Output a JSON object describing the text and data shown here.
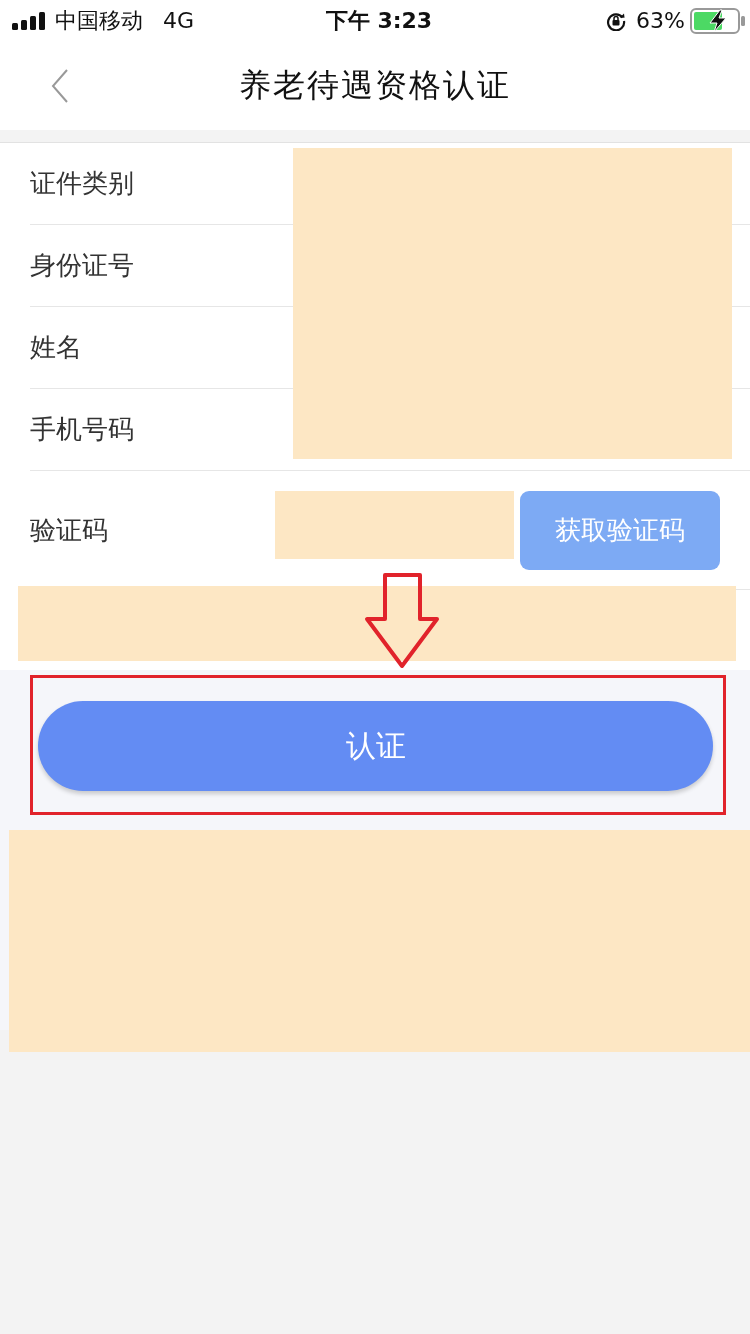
{
  "status_bar": {
    "carrier": "中国移动",
    "network": "4G",
    "time": "下午 3:23",
    "battery": "63%"
  },
  "nav_bar": {
    "title": "养老待遇资格认证"
  },
  "form": {
    "fields": [
      {
        "label": "证件类别",
        "kind": "text"
      },
      {
        "label": "身份证号",
        "kind": "text"
      },
      {
        "label": "姓名",
        "kind": "text"
      },
      {
        "label": "手机号码",
        "kind": "text"
      },
      {
        "label": "验证码",
        "kind": "code",
        "button": "获取验证码"
      }
    ]
  },
  "submit_button": "认证"
}
